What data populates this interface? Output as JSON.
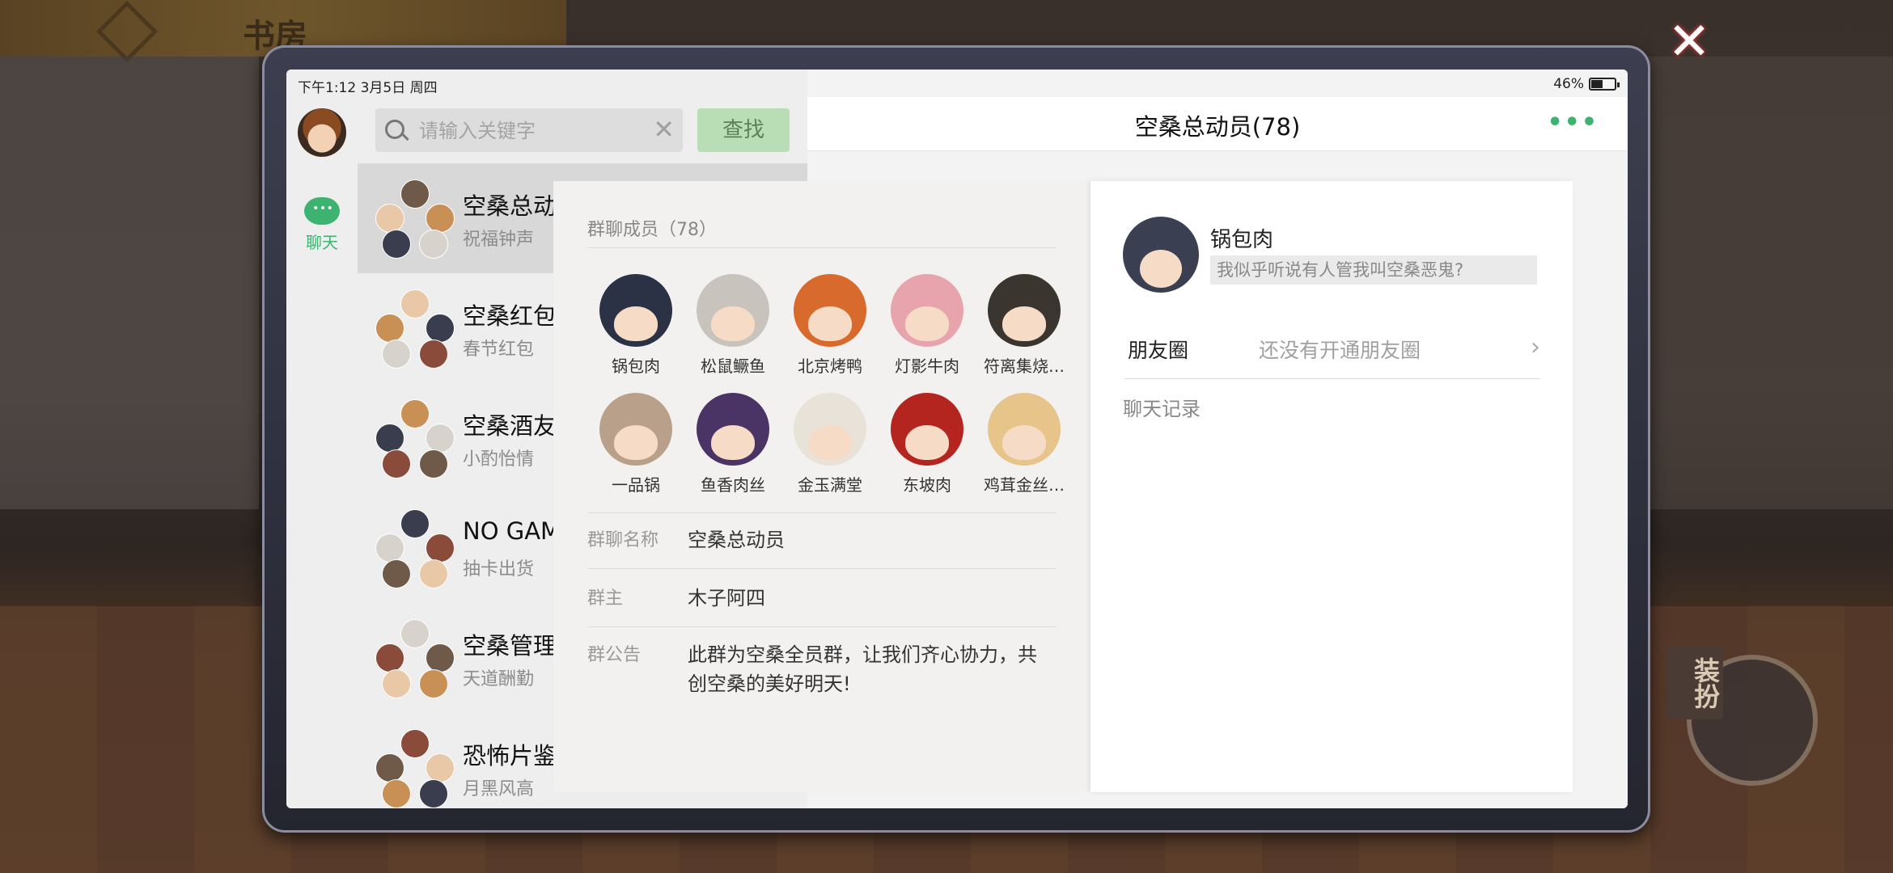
{
  "game": {
    "top_title": "书房",
    "close_label": "✕",
    "side_button": "装扮"
  },
  "status": {
    "time": "下午1:12  3月5日  周四",
    "battery": "46%"
  },
  "nav": {
    "chat_tab": "聊天"
  },
  "search": {
    "placeholder": "请输入关键字",
    "button": "查找"
  },
  "chats": [
    {
      "name": "空桑总动",
      "preview": "祝福钟声",
      "selected": true
    },
    {
      "name": "空桑红包",
      "preview": "春节红包",
      "selected": false
    },
    {
      "name": "空桑酒友",
      "preview": "小酌怡情",
      "selected": false
    },
    {
      "name": "NO GAM",
      "preview": "抽卡出货",
      "selected": false
    },
    {
      "name": "空桑管理",
      "preview": "天道酬勤",
      "selected": false
    },
    {
      "name": "恐怖片鉴",
      "preview": "月黑风高",
      "selected": false
    }
  ],
  "conversation": {
    "title": "空桑总动员(78)",
    "more": "•••"
  },
  "group": {
    "members_heading": "群聊成员（78）",
    "members": [
      {
        "name": "锅包肉",
        "color": "#2c3245"
      },
      {
        "name": "松鼠鳜鱼",
        "color": "#c9c3bd"
      },
      {
        "name": "北京烤鸭",
        "color": "#d96a2e"
      },
      {
        "name": "灯影牛肉",
        "color": "#e8a4ad"
      },
      {
        "name": "符离集烧…",
        "color": "#3b3530"
      },
      {
        "name": "一品锅",
        "color": "#b8a08a"
      },
      {
        "name": "鱼香肉丝",
        "color": "#4a3466"
      },
      {
        "name": "金玉满堂",
        "color": "#e9e2d8"
      },
      {
        "name": "东坡肉",
        "color": "#b5251f"
      },
      {
        "name": "鸡茸金丝…",
        "color": "#e7c48a"
      }
    ],
    "name_label": "群聊名称",
    "name_value": "空桑总动员",
    "owner_label": "群主",
    "owner_value": "木子阿四",
    "notice_label": "群公告",
    "notice_value": "此群为空桑全员群，让我们齐心协力，共创空桑的美好明天!"
  },
  "profile": {
    "name": "锅包肉",
    "signature": "我似乎听说有人管我叫空桑恶鬼?",
    "moments_label": "朋友圈",
    "moments_value": "还没有开通朋友圈",
    "records_label": "聊天记录"
  }
}
